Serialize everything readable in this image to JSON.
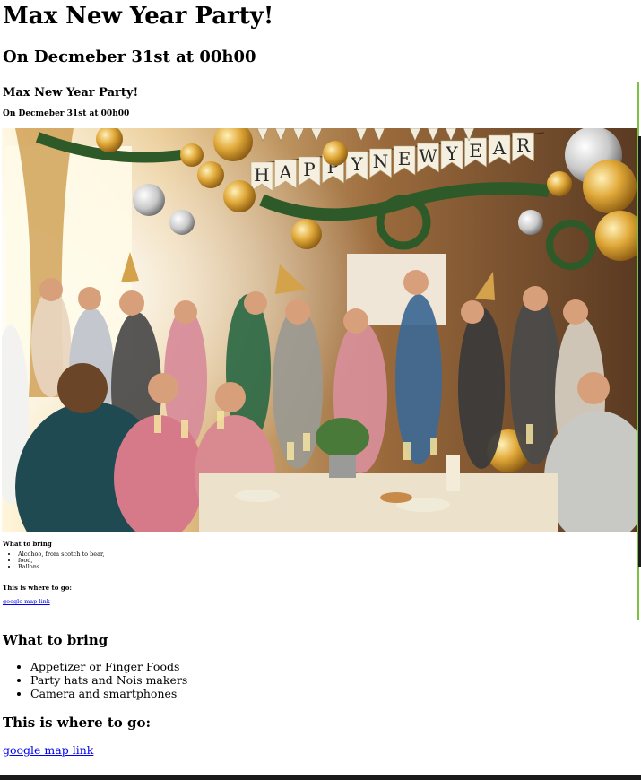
{
  "header": {
    "title": "Max New Year Party!",
    "subtitle": "On Decmeber 31st at 00h00"
  },
  "preview": {
    "title": "Max New Year Party!",
    "subtitle": "On Decmeber 31st at 00h00",
    "image_alt": "party-photo",
    "banner_letters": [
      "H",
      "A",
      "P",
      "P",
      "Y",
      "N",
      "E",
      "W",
      "Y",
      "E",
      "A",
      "R"
    ],
    "bring_heading": "What to bring",
    "bring_items": [
      "Alcohoo, from scotch to bear,",
      "food,",
      "Ballons"
    ],
    "where_heading": "This is where to go:",
    "map_link": "google map link"
  },
  "main": {
    "bring_heading": "What to bring",
    "bring_items": [
      "Appetizer or Finger Foods",
      "Party hats and Nois makers",
      "Camera and smartphones"
    ],
    "where_heading": "This is where to go:",
    "map_link": "google map link"
  },
  "colors": {
    "link": "#0000ee",
    "frame_accent": "#7cc242",
    "gold": "#d4a24a"
  }
}
